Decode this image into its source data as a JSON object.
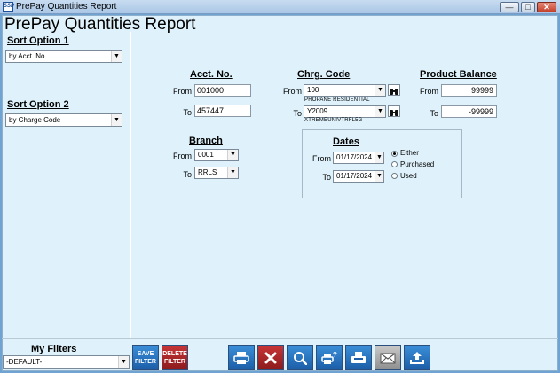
{
  "window": {
    "app_icon_text": "SSP",
    "title": "PrePay Quantities Report"
  },
  "report_title": "PrePay Quantities Report",
  "sort": {
    "option1_label": "Sort Option 1",
    "option1_value": "by Acct. No.",
    "option2_label": "Sort Option 2",
    "option2_value": "by Charge Code"
  },
  "acct": {
    "header": "Acct. No.",
    "from_label": "From",
    "from_value": "001000",
    "to_label": "To",
    "to_value": "457447"
  },
  "chrg": {
    "header": "Chrg. Code",
    "from_label": "From",
    "from_value": "100",
    "from_desc": "PROPANE RESIDENTIAL",
    "to_label": "To",
    "to_value": "Y2009",
    "to_desc": "XTREMEUNIVTRFL5G"
  },
  "balance": {
    "header": "Product Balance",
    "from_label": "From",
    "from_value": "99999",
    "to_label": "To",
    "to_value": "-99999"
  },
  "branch": {
    "header": "Branch",
    "from_label": "From",
    "from_value": "0001",
    "to_label": "To",
    "to_value": "RRLS"
  },
  "dates": {
    "header": "Dates",
    "from_label": "From",
    "from_value": "01/17/2024",
    "to_label": "To",
    "to_value": "01/17/2024",
    "options": [
      "Either",
      "Purchased",
      "Used"
    ],
    "selected": "Either"
  },
  "filters": {
    "label": "My Filters",
    "value": "-DEFAULT-",
    "save_label_1": "SAVE",
    "save_label_2": "FILTER",
    "delete_label_1": "DELETE",
    "delete_label_2": "FILTER"
  },
  "icons": {
    "print": "printer-icon",
    "cancel": "close-x-icon",
    "preview": "magnifier-icon",
    "print_setup": "printer-question-icon",
    "fax": "fax-icon",
    "email": "envelope-icon",
    "export": "upload-icon"
  },
  "colors": {
    "button_blue": "#1c5ea8",
    "button_red": "#8c1a1c",
    "client_bg": "#dff2fb"
  }
}
